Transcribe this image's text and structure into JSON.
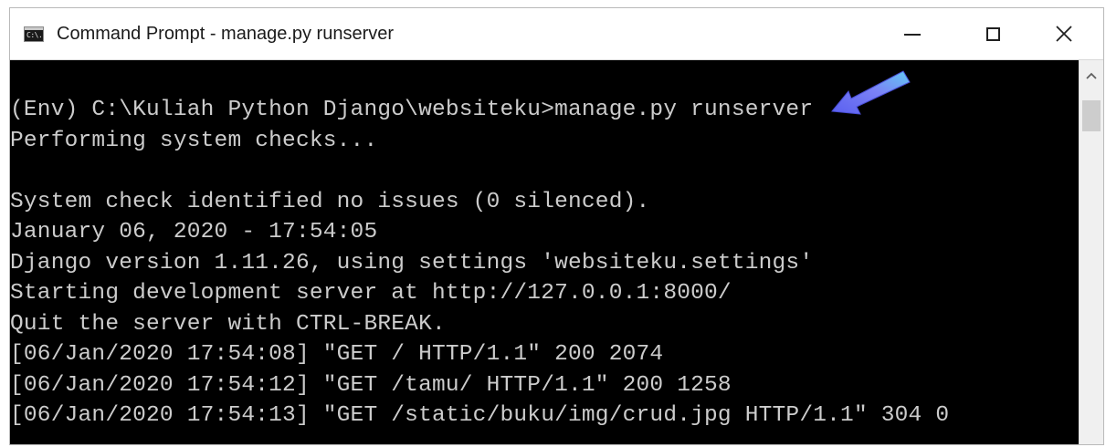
{
  "window": {
    "title": "Command Prompt - manage.py  runserver",
    "icon_text": "C:\\."
  },
  "controls": {
    "minimize": "minimize-icon",
    "maximize": "maximize-icon",
    "close": "close-icon"
  },
  "console": {
    "lines": [
      "(Env) C:\\Kuliah Python Django\\websiteku>manage.py runserver",
      "Performing system checks...",
      "",
      "System check identified no issues (0 silenced).",
      "January 06, 2020 - 17:54:05",
      "Django version 1.11.26, using settings 'websiteku.settings'",
      "Starting development server at http://127.0.0.1:8000/",
      "Quit the server with CTRL-BREAK.",
      "[06/Jan/2020 17:54:08] \"GET / HTTP/1.1\" 200 2074",
      "[06/Jan/2020 17:54:12] \"GET /tamu/ HTTP/1.1\" 200 1258",
      "[06/Jan/2020 17:54:13] \"GET /static/buku/img/crud.jpg HTTP/1.1\" 304 0"
    ]
  },
  "annotation": {
    "arrow_icon": "pointer-arrow-icon",
    "arrow_color": "#6e73f2"
  },
  "colors": {
    "console_bg": "#000000",
    "console_text": "#cccccc",
    "titlebar_bg": "#ffffff"
  }
}
